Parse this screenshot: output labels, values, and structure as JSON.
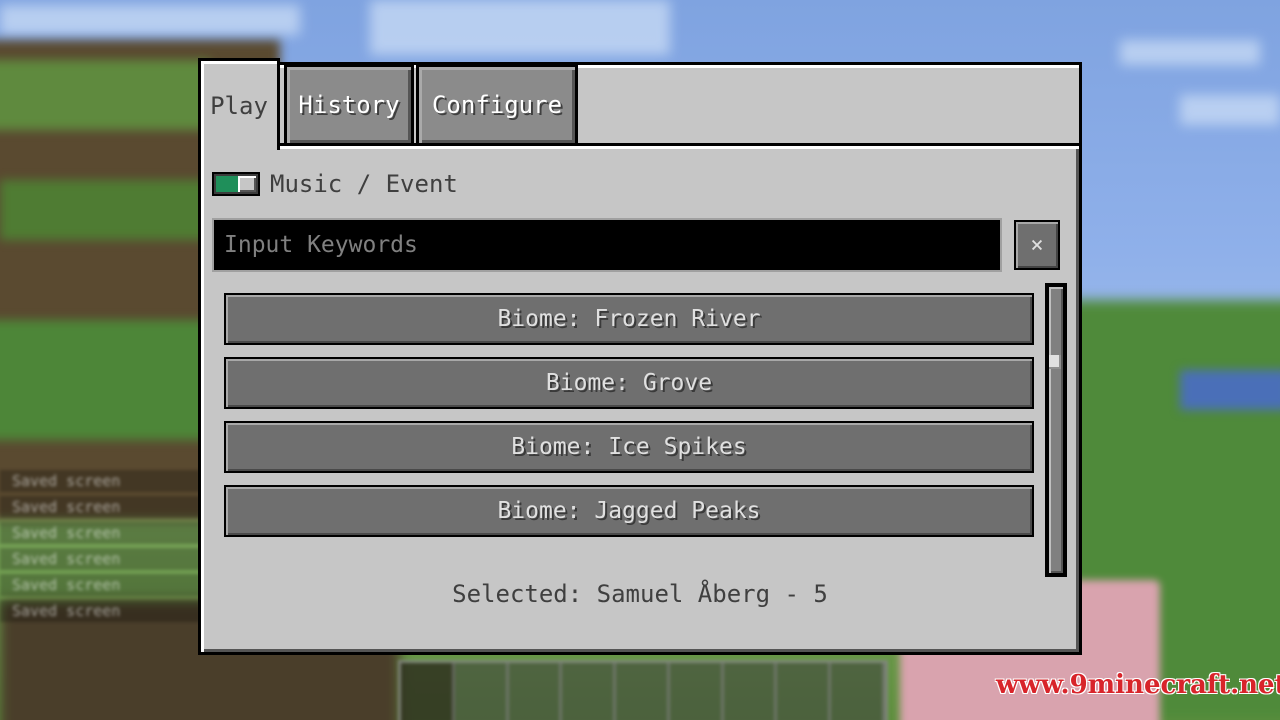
{
  "tabs": [
    {
      "label": "Play",
      "active": true
    },
    {
      "label": "History",
      "active": false
    },
    {
      "label": "Configure",
      "active": false
    }
  ],
  "toggle": {
    "label": "Music / Event",
    "state": "on",
    "color": "#1f8f5a"
  },
  "search": {
    "placeholder": "Input Keywords",
    "value": "",
    "clear_label": "×"
  },
  "list": {
    "items": [
      {
        "label": "Biome: Frozen River"
      },
      {
        "label": "Biome: Grove"
      },
      {
        "label": "Biome: Ice Spikes"
      },
      {
        "label": "Biome: Jagged Peaks"
      }
    ],
    "scroll_position": 0.25
  },
  "status": {
    "selected": "Selected: Samuel Åberg - 5"
  },
  "background": {
    "chat_lines": [
      "Saved screen",
      "Saved screen",
      "Saved screen",
      "Saved screen",
      "Saved screen",
      "Saved screen"
    ],
    "hotbar_slots": 9
  },
  "watermark": "www.9minecraft.net"
}
